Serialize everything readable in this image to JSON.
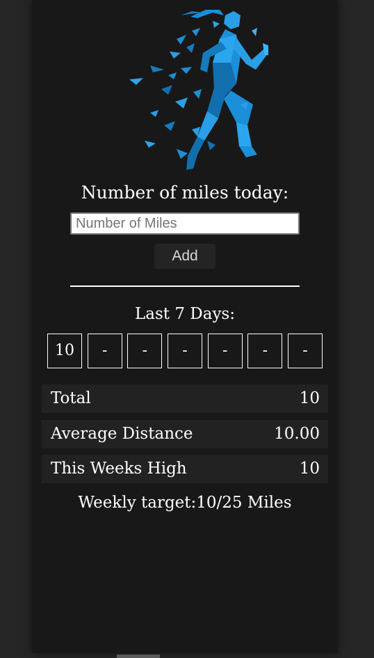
{
  "icons": {
    "hero": "runner-icon"
  },
  "colors": {
    "background": "#262626",
    "panel": "#181818",
    "stat_row": "#222222",
    "runner_blue": "#1b8fd8",
    "text": "#ffffff"
  },
  "form": {
    "prompt": "Number of miles today:",
    "input_placeholder": "Number of Miles",
    "input_value": "",
    "add_label": "Add"
  },
  "last_days": {
    "heading": "Last 7 Days:",
    "values": [
      "10",
      "-",
      "-",
      "-",
      "-",
      "-",
      "-"
    ]
  },
  "stats": {
    "total_label": "Total",
    "total_value": "10",
    "average_label": "Average Distance",
    "average_value": "10.00",
    "high_label": "This Weeks High",
    "high_value": "10"
  },
  "target": {
    "text": "Weekly target:10/25 Miles"
  }
}
